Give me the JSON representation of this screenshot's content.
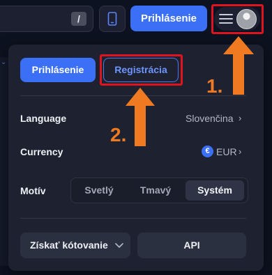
{
  "topbar": {
    "search_shortcut": "/",
    "login_label": "Prihlásenie"
  },
  "menu": {
    "login_label": "Prihlásenie",
    "register_label": "Registrácia",
    "language": {
      "label": "Language",
      "value": "Slovenčina"
    },
    "currency": {
      "label": "Currency",
      "symbol": "€",
      "value": "EUR"
    },
    "theme": {
      "label": "Motív",
      "options": [
        "Svetlý",
        "Tmavý",
        "Systém"
      ],
      "selected": "Systém"
    },
    "quote_label": "Získať kótovanie",
    "api_label": "API"
  },
  "annotations": {
    "step1": "1.",
    "step2": "2."
  },
  "colors": {
    "accent": "#3b6ff5",
    "highlight": "#e0141e",
    "arrow": "#f07a22",
    "panel": "#1e2230"
  }
}
